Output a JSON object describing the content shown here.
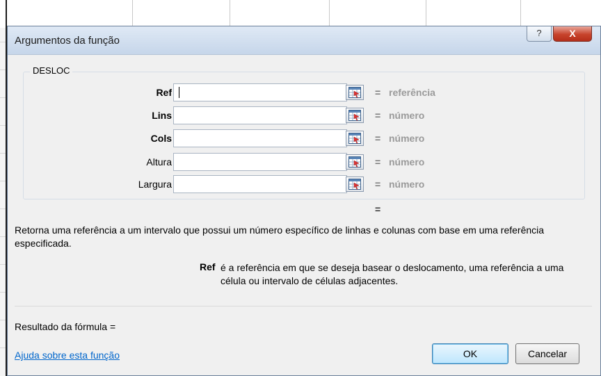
{
  "dialog": {
    "title": "Argumentos da função",
    "help_glyph": "?",
    "close_glyph": "X",
    "function_name": "DESLOC",
    "result_equals": "=",
    "description": "Retorna uma referência a um intervalo que possui um número específico de linhas e colunas com base em uma referência especificada.",
    "arg_help": {
      "name": "Ref",
      "text": "é a referência em que se deseja basear o deslocamento, uma referência a uma célula ou intervalo de células adjacentes."
    },
    "formula_result_label": "Resultado da fórmula =",
    "help_link": "Ajuda sobre esta função",
    "ok_label": "OK",
    "cancel_label": "Cancelar"
  },
  "args": [
    {
      "label": "Ref",
      "bold": true,
      "value": "",
      "equals": "=",
      "hint": "referência"
    },
    {
      "label": "Lins",
      "bold": true,
      "value": "",
      "equals": "=",
      "hint": "número"
    },
    {
      "label": "Cols",
      "bold": true,
      "value": "",
      "equals": "=",
      "hint": "número"
    },
    {
      "label": "Altura",
      "bold": false,
      "value": "",
      "equals": "=",
      "hint": "número"
    },
    {
      "label": "Largura",
      "bold": false,
      "value": "",
      "equals": "=",
      "hint": "número"
    }
  ],
  "icons": {
    "collapse_dialog": "range-select-icon"
  }
}
